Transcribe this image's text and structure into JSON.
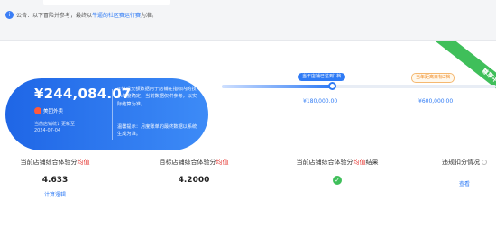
{
  "notice": {
    "prefix": "公告：以下冒险并参考，最终以",
    "link": "牛逼的社区赛运行赛",
    "suffix": "为准。"
  },
  "ribbon": {
    "label": "尊享中"
  },
  "card": {
    "amount": "¥244,084.07",
    "tag": "美团外卖",
    "sub1": "当前店铺统计更新至",
    "sub2": "2024-07-04",
    "desc": "①该成交额数据用于店铺在指标内的技术年度确定，当前数据仅供参考，以实际结算为准。",
    "tip": "温馨提示：月度账单的最终数据以系统生成为准。"
  },
  "progress": {
    "fill_fraction": 0.4,
    "current_label": "当年店铺已达到1档",
    "target_label": "当年距离目标2档",
    "tick1": "¥180,000.00",
    "tick2": "¥600,000.00"
  },
  "metrics": {
    "m1": {
      "title_pre": "当前店铺综合体验分",
      "title_hl": "均值",
      "value": "4.633",
      "link": "计算逻辑"
    },
    "m2": {
      "title_pre": "目标店铺综合体验分",
      "title_hl": "均值",
      "value": "4.2000"
    },
    "m3": {
      "title_pre": "当前店铺综合体验分",
      "title_hl": "均值",
      "title_post": "结果"
    },
    "m4": {
      "title": "违规扣分情况",
      "link": "查看"
    }
  },
  "colors": {
    "accent": "#2f7bf5",
    "highlight": "#e5322d",
    "success": "#3fbf5a",
    "warning": "#f08a24"
  }
}
